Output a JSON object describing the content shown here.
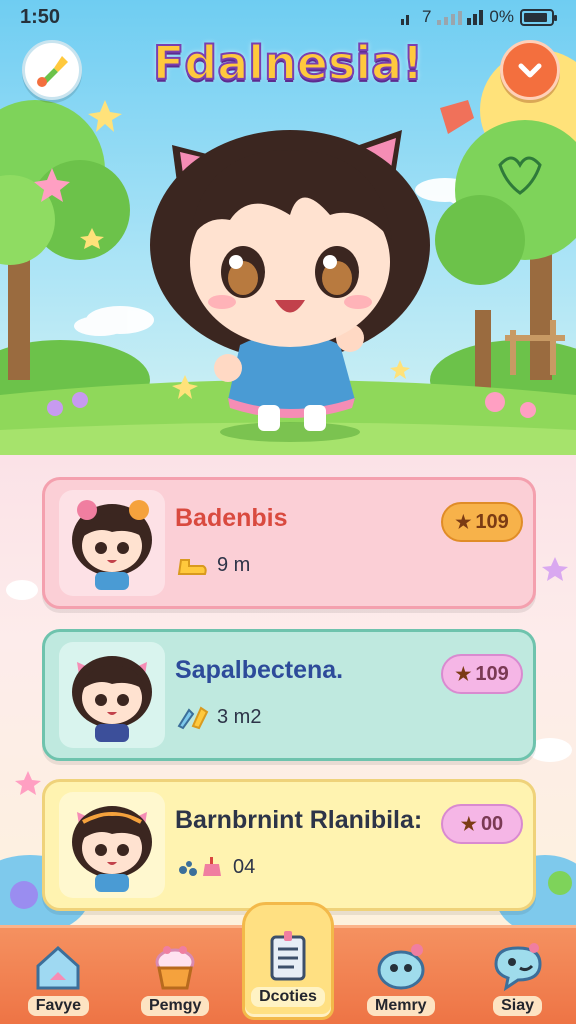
{
  "status_bar": {
    "time": "1:50",
    "network": "7",
    "battery_text": "0%",
    "battery_level": 0.9
  },
  "game": {
    "title": "Fdalnesia!"
  },
  "quests": [
    {
      "name": "Badenbis",
      "meta": "9 m",
      "meta_icon": "boot-icon",
      "reward": "109",
      "theme": "pink"
    },
    {
      "name": "Sapalbectena.",
      "meta": "3 m2",
      "meta_icon": "paint-icon",
      "reward": "109",
      "theme": "mint"
    },
    {
      "name": "Barnbrnint Rlanibila:",
      "meta": "04",
      "meta_icon": "paw-cake-icon",
      "reward": "00",
      "theme": "yellow"
    }
  ],
  "nav": [
    {
      "label": "Favye",
      "icon": "house-icon"
    },
    {
      "label": "Pemgy",
      "icon": "cupcake-icon"
    },
    {
      "label": "Dcoties",
      "icon": "notes-icon",
      "active": true
    },
    {
      "label": "Memry",
      "icon": "creature-icon"
    },
    {
      "label": "Siay",
      "icon": "chat-icon"
    }
  ],
  "colors": {
    "accent": "#ee7445",
    "sky": "#6fcdf2",
    "grass": "#8fd85a"
  }
}
